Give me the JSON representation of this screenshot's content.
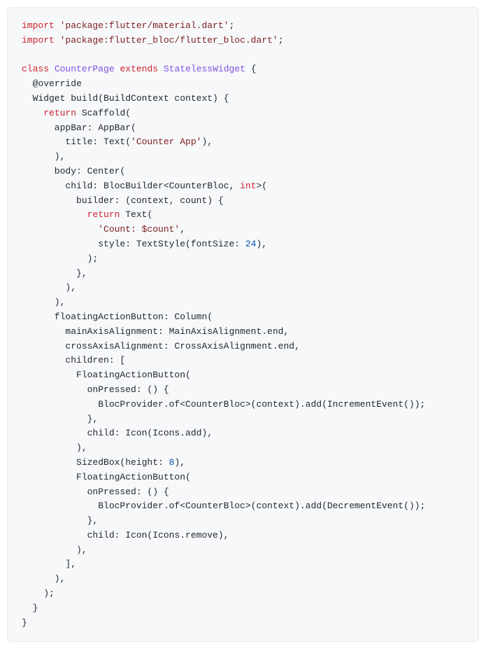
{
  "code": {
    "l1a": "import",
    "l1b": " ",
    "l1c": "'package:flutter/material.dart'",
    "l1d": ";",
    "l2a": "import",
    "l2b": " ",
    "l2c": "'package:flutter_bloc/flutter_bloc.dart'",
    "l2d": ";",
    "l4a": "class",
    "l4b": " ",
    "l4c": "CounterPage",
    "l4d": " ",
    "l4e": "extends",
    "l4f": " ",
    "l4g": "StatelessWidget",
    "l4h": " {",
    "l5a": "  ",
    "l5b": "@override",
    "l6a": "  Widget build(BuildContext context) {",
    "l7a": "    ",
    "l7b": "return",
    "l7c": " Scaffold(",
    "l8a": "      appBar: AppBar(",
    "l9a": "        title: Text(",
    "l9b": "'Counter App'",
    "l9c": "),",
    "l10a": "      ),",
    "l11a": "      body: Center(",
    "l12a": "        child: BlocBuilder<CounterBloc, ",
    "l12b": "int",
    "l12c": ">(",
    "l13a": "          builder: (context, count) {",
    "l14a": "            ",
    "l14b": "return",
    "l14c": " Text(",
    "l15a": "              ",
    "l15b": "'Count: $count'",
    "l15c": ",",
    "l16a": "              style: TextStyle(fontSize: ",
    "l16b": "24",
    "l16c": "),",
    "l17a": "            );",
    "l18a": "          },",
    "l19a": "        ),",
    "l20a": "      ),",
    "l21a": "      floatingActionButton: Column(",
    "l22a": "        mainAxisAlignment: MainAxisAlignment.end,",
    "l23a": "        crossAxisAlignment: CrossAxisAlignment.end,",
    "l24a": "        children: [",
    "l25a": "          FloatingActionButton(",
    "l26a": "            onPressed: () {",
    "l27a": "              BlocProvider.of<CounterBloc>(context).add(IncrementEvent());",
    "l28a": "            },",
    "l29a": "            child: Icon(Icons.add),",
    "l30a": "          ),",
    "l31a": "          SizedBox(height: ",
    "l31b": "8",
    "l31c": "),",
    "l32a": "          FloatingActionButton(",
    "l33a": "            onPressed: () {",
    "l34a": "              BlocProvider.of<CounterBloc>(context).add(DecrementEvent());",
    "l35a": "            },",
    "l36a": "            child: Icon(Icons.remove),",
    "l37a": "          ),",
    "l38a": "        ],",
    "l39a": "      ),",
    "l40a": "    );",
    "l41a": "  }",
    "l42a": "}"
  }
}
